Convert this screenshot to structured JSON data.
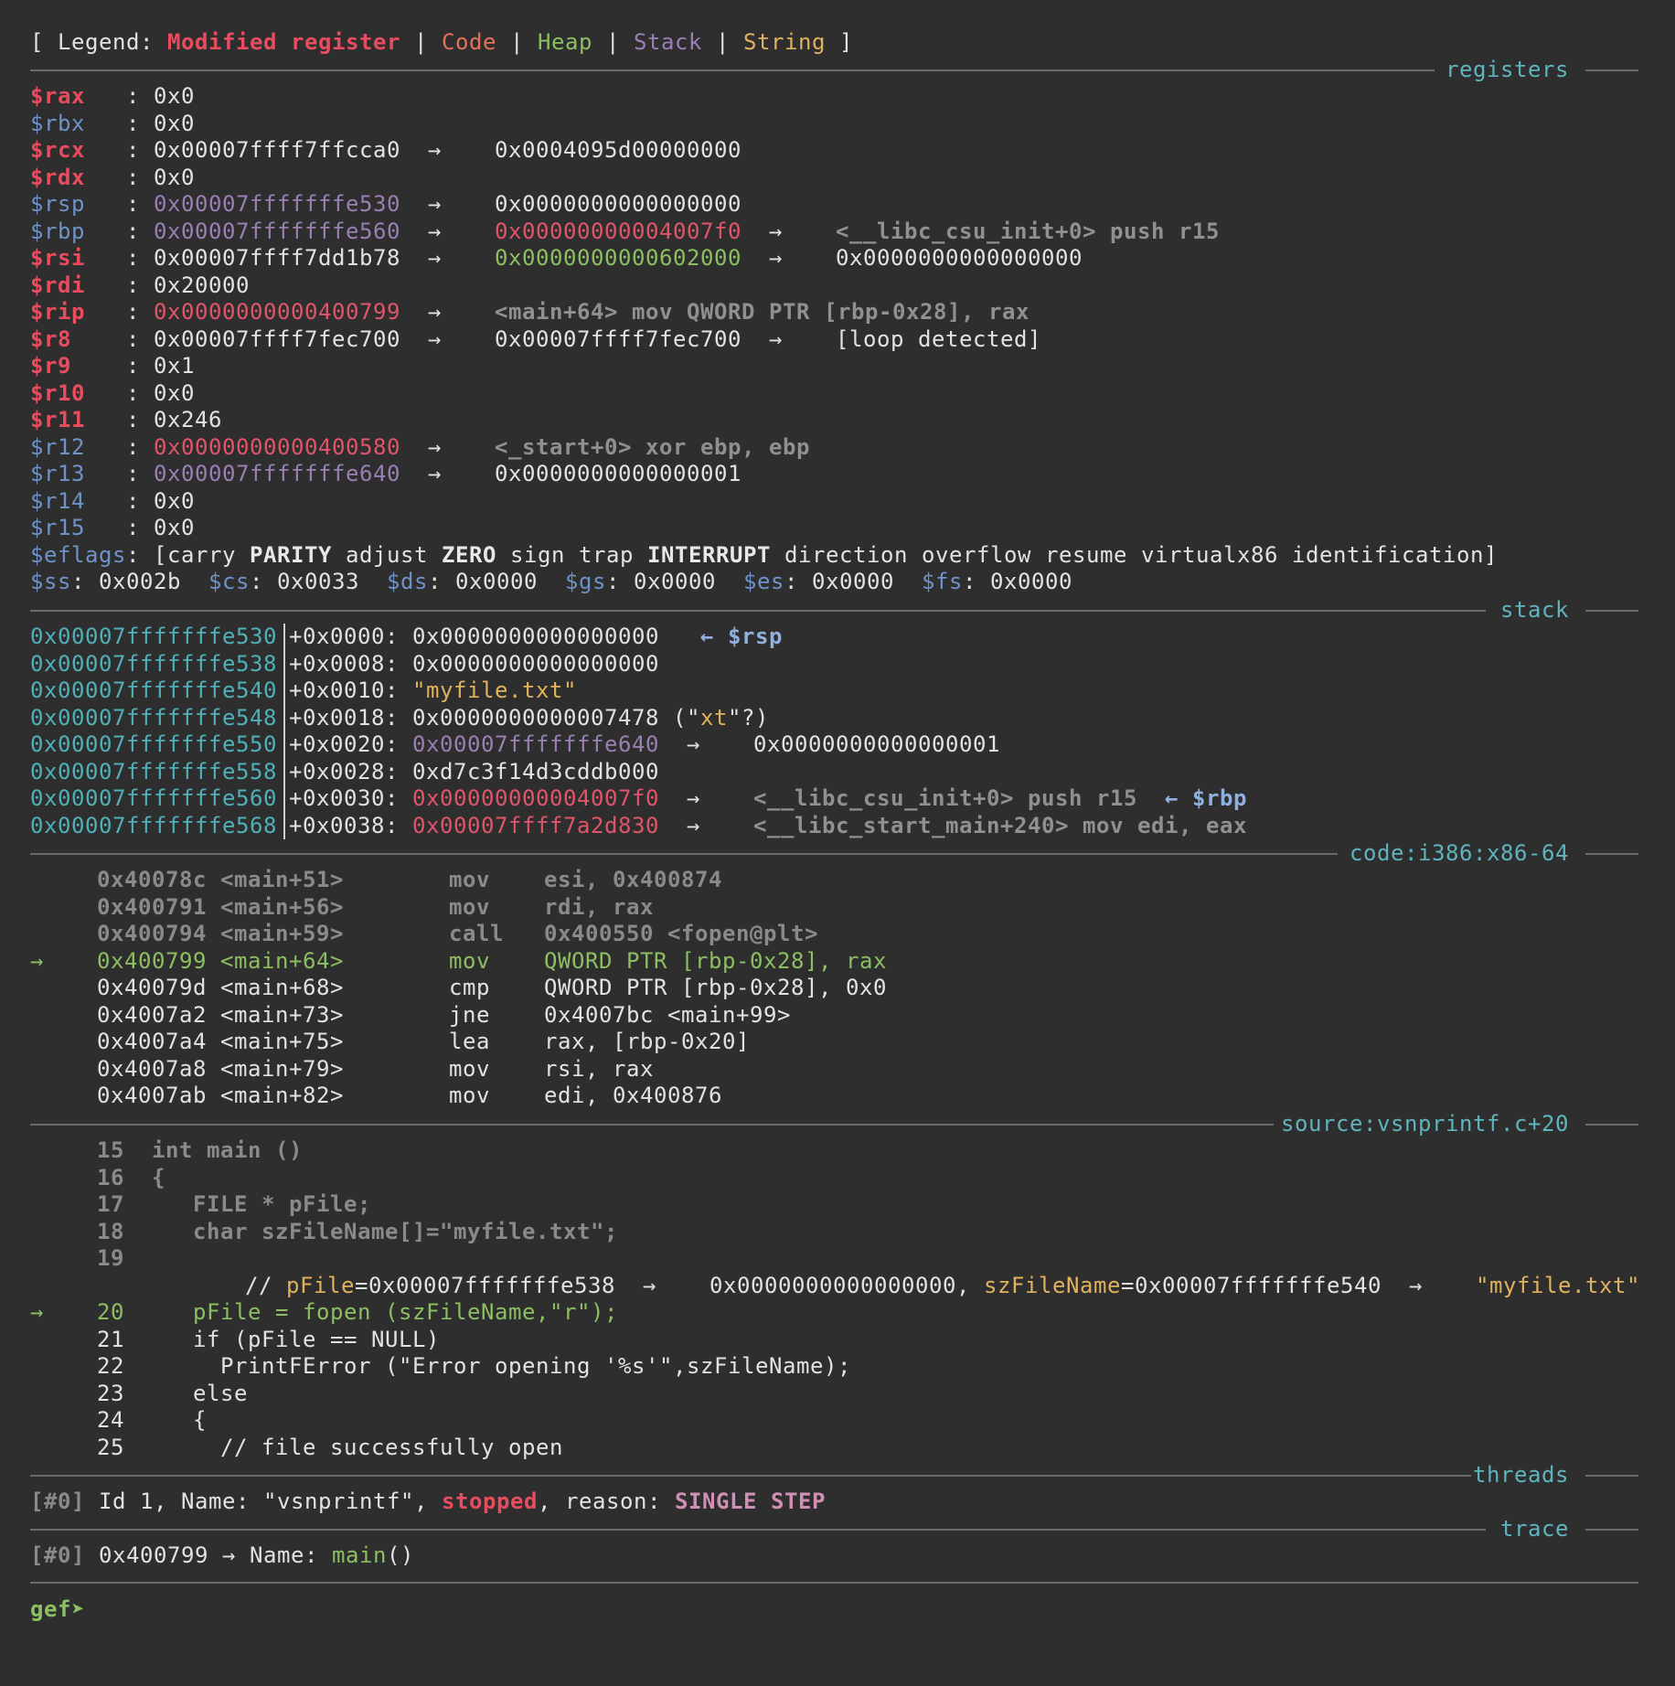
{
  "legend": {
    "open": "[ Legend: ",
    "modified_register": "Modified register",
    "code": "Code",
    "heap": "Heap",
    "stack": "Stack",
    "string": "String",
    "sep": " | ",
    "close": " ]"
  },
  "sections": {
    "registers": "registers",
    "stack": "stack",
    "code": "code:i386:x86-64",
    "source": "source:vsnprintf.c+20",
    "threads": "threads",
    "trace": "trace"
  },
  "registers": [
    {
      "name": "$rax",
      "value": "0x0"
    },
    {
      "name": "$rbx",
      "value": "0x0"
    },
    {
      "name": "$rcx",
      "value": "0x00007ffff7ffcca0",
      "arrow": "→",
      "v2": "0x0004095d00000000"
    },
    {
      "name": "$rdx",
      "value": "0x0"
    },
    {
      "name": "$rsp",
      "value": "0x00007fffffffe530",
      "arrow": "→",
      "v2": "0x0000000000000000"
    },
    {
      "name": "$rbp",
      "value": "0x00007fffffffe560",
      "arrow": "→",
      "v2": "0x00000000004007f0",
      "arrow2": "→",
      "v3": "<__libc_csu_init+0> push r15"
    },
    {
      "name": "$rsi",
      "value": "0x00007ffff7dd1b78",
      "arrow": "→",
      "v2": "0x0000000000602000",
      "arrow2": "→",
      "v3": "0x0000000000000000"
    },
    {
      "name": "$rdi",
      "value": "0x20000"
    },
    {
      "name": "$rip",
      "value": "0x0000000000400799",
      "arrow": "→",
      "v2": "<main+64> mov QWORD PTR [rbp-0x28], rax"
    },
    {
      "name": "$r8",
      "value": "0x00007ffff7fec700",
      "arrow": "→",
      "v2": "0x00007ffff7fec700",
      "arrow2": "→",
      "v3": "[loop detected]"
    },
    {
      "name": "$r9",
      "value": "0x1"
    },
    {
      "name": "$r10",
      "value": "0x0"
    },
    {
      "name": "$r11",
      "value": "0x246"
    },
    {
      "name": "$r12",
      "value": "0x0000000000400580",
      "arrow": "→",
      "v2": "<_start+0> xor ebp, ebp"
    },
    {
      "name": "$r13",
      "value": "0x00007fffffffe640",
      "arrow": "→",
      "v2": "0x0000000000000001"
    },
    {
      "name": "$r14",
      "value": "0x0"
    },
    {
      "name": "$r15",
      "value": "0x0"
    }
  ],
  "colon": ": ",
  "eflags": {
    "name": "$eflags",
    "open": "[",
    "carry": "carry",
    "parity": "PARITY",
    "adjust": "adjust",
    "zero": "ZERO",
    "sign": "sign",
    "trap": "trap",
    "interrupt": "INTERRUPT",
    "direction": "direction",
    "overflow": "overflow",
    "resume": "resume",
    "virtualx86": "virtualx86",
    "identification": "identification",
    "close": "]"
  },
  "segments": [
    {
      "name": "$ss",
      "value": "0x002b"
    },
    {
      "name": "$cs",
      "value": "0x0033"
    },
    {
      "name": "$ds",
      "value": "0x0000"
    },
    {
      "name": "$gs",
      "value": "0x0000"
    },
    {
      "name": "$es",
      "value": "0x0000"
    },
    {
      "name": "$fs",
      "value": "0x0000"
    }
  ],
  "stack": [
    {
      "addr": "0x00007fffffffe530",
      "off": "+0x0000",
      "value": "0x0000000000000000",
      "marker": "← $rsp"
    },
    {
      "addr": "0x00007fffffffe538",
      "off": "+0x0008",
      "value": "0x0000000000000000"
    },
    {
      "addr": "0x00007fffffffe540",
      "off": "+0x0010",
      "value": "\"myfile.txt\""
    },
    {
      "addr": "0x00007fffffffe548",
      "off": "+0x0018",
      "value": "0x0000000000007478",
      "hint_open": " (\"",
      "hint": "xt",
      "hint_close": "\"?)"
    },
    {
      "addr": "0x00007fffffffe550",
      "off": "+0x0020",
      "value": "0x00007fffffffe640",
      "arrow": "→",
      "v2": "0x0000000000000001"
    },
    {
      "addr": "0x00007fffffffe558",
      "off": "+0x0028",
      "value": "0xd7c3f14d3cddb000"
    },
    {
      "addr": "0x00007fffffffe560",
      "off": "+0x0030",
      "value": "0x00000000004007f0",
      "arrow": "→",
      "v2": "<__libc_csu_init+0> push r15",
      "marker": "← $rbp"
    },
    {
      "addr": "0x00007fffffffe568",
      "off": "+0x0038",
      "value": "0x00007ffff7a2d830",
      "arrow": "→",
      "v2": "<__libc_start_main+240> mov edi, eax"
    }
  ],
  "code": [
    {
      "addr": "0x40078c",
      "sym": "<main+51>",
      "op": "mov",
      "args": "esi, 0x400874"
    },
    {
      "addr": "0x400791",
      "sym": "<main+56>",
      "op": "mov",
      "args": "rdi, rax"
    },
    {
      "addr": "0x400794",
      "sym": "<main+59>",
      "op": "call",
      "args": "0x400550 <fopen@plt>"
    },
    {
      "addr": "0x400799",
      "sym": "<main+64>",
      "op": "mov",
      "args": "QWORD PTR [rbp-0x28], rax",
      "current": true,
      "arrow": "→"
    },
    {
      "addr": "0x40079d",
      "sym": "<main+68>",
      "op": "cmp",
      "args": "QWORD PTR [rbp-0x28], 0x0"
    },
    {
      "addr": "0x4007a2",
      "sym": "<main+73>",
      "op": "jne",
      "args": "0x4007bc <main+99>"
    },
    {
      "addr": "0x4007a4",
      "sym": "<main+75>",
      "op": "lea",
      "args": "rax, [rbp-0x20]"
    },
    {
      "addr": "0x4007a8",
      "sym": "<main+79>",
      "op": "mov",
      "args": "rsi, rax"
    },
    {
      "addr": "0x4007ab",
      "sym": "<main+82>",
      "op": "mov",
      "args": "edi, 0x400876"
    }
  ],
  "source": [
    {
      "num": "15",
      "text": "int main ()"
    },
    {
      "num": "16",
      "text": "{"
    },
    {
      "num": "17",
      "text": "   FILE * pFile;"
    },
    {
      "num": "18",
      "text": "   char szFileName[]=\"myfile.txt\";"
    },
    {
      "num": "19",
      "text": ""
    },
    {
      "num": "20",
      "text": "   pFile = fopen (szFileName,\"r\");",
      "current": true,
      "arrow": "→"
    },
    {
      "num": "21",
      "text": "   if (pFile == NULL)"
    },
    {
      "num": "22",
      "text": "     PrintFError (\"Error opening '%s'\",szFileName);"
    },
    {
      "num": "23",
      "text": "   else"
    },
    {
      "num": "24",
      "text": "   {"
    },
    {
      "num": "25",
      "text": "     // file successfully open"
    }
  ],
  "source_comment": {
    "prefix": "// ",
    "var1": "pFile",
    "val1": "=0x00007fffffffe538",
    "arrow1": "→",
    "val1b": "0x0000000000000000, ",
    "var2": "szFileName",
    "val2": "=0x00007fffffffe540",
    "arrow2": "→",
    "val2b": "\"myfile.txt\""
  },
  "threads": {
    "id": "[#0]",
    "text1": " Id 1, Name: \"vsnprintf\", ",
    "state": "stopped",
    "text2": ", reason: ",
    "reason": "SINGLE STEP"
  },
  "trace": {
    "id": "[#0]",
    "text": " 0x400799 → Name: ",
    "func": "main",
    "parens": "()"
  },
  "prompt": "gef➤"
}
